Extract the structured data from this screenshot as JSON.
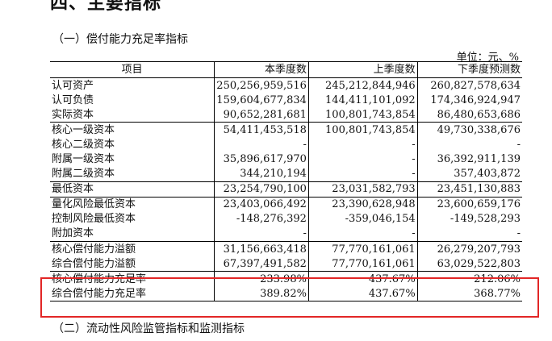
{
  "page": {
    "heading": "四、主要指标",
    "section1_title": "（一）偿付能力充足率指标",
    "unit": "单位：元、%",
    "section2_title": "（二）流动性风险监管指标和监测指标"
  },
  "table": {
    "headers": [
      "项目",
      "本季度数",
      "上季度数",
      "下季度预测数"
    ],
    "rows": [
      {
        "item": "认可资产",
        "cur": "250,256,959,516",
        "prev": "245,212,844,946",
        "next": "260,827,578,634",
        "group_top": false
      },
      {
        "item": "认可负债",
        "cur": "159,604,677,834",
        "prev": "144,411,101,092",
        "next": "174,346,924,947",
        "group_top": false
      },
      {
        "item": "实际资本",
        "cur": "90,652,281,681",
        "prev": "100,801,743,854",
        "next": "86,480,653,686",
        "group_top": false
      },
      {
        "item": "核心一级资本",
        "cur": "54,411,453,518",
        "prev": "100,801,743,854",
        "next": "49,730,338,676",
        "group_top": true
      },
      {
        "item": "核心二级资本",
        "cur": "-",
        "prev": "-",
        "next": "-",
        "group_top": false
      },
      {
        "item": "附属一级资本",
        "cur": "35,896,617,970",
        "prev": "-",
        "next": "36,392,911,139",
        "group_top": false
      },
      {
        "item": "附属二级资本",
        "cur": "344,210,194",
        "prev": "-",
        "next": "357,403,872",
        "group_top": false
      },
      {
        "item": "最低资本",
        "cur": "23,254,790,100",
        "prev": "23,031,582,793",
        "next": "23,451,130,883",
        "group_top": true
      },
      {
        "item": "量化风险最低资本",
        "cur": "23,403,066,492",
        "prev": "23,390,628,948",
        "next": "23,600,659,176",
        "group_top": true
      },
      {
        "item": "控制风险最低资本",
        "cur": "-148,276,392",
        "prev": "-359,046,154",
        "next": "-149,528,293",
        "group_top": false
      },
      {
        "item": "附加资本",
        "cur": "-",
        "prev": "-",
        "next": "-",
        "group_top": false
      },
      {
        "item": "核心偿付能力溢额",
        "cur": "31,156,663,418",
        "prev": "77,770,161,061",
        "next": "26,279,207,793",
        "group_top": true
      },
      {
        "item": "综合偿付能力溢额",
        "cur": "67,397,491,582",
        "prev": "77,770,161,061",
        "next": "63,029,522,803",
        "group_top": false
      },
      {
        "item": "核心偿付能力充足率",
        "cur": "233.98%",
        "prev": "437.67%",
        "next": "212.06%",
        "group_top": true
      },
      {
        "item": "综合偿付能力充足率",
        "cur": "389.82%",
        "prev": "437.67%",
        "next": "368.77%",
        "group_top": false
      }
    ]
  },
  "colors": {
    "highlight_border": "#e22626"
  }
}
